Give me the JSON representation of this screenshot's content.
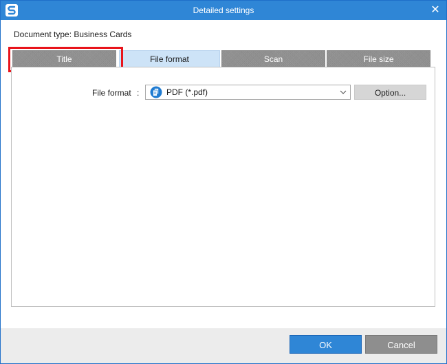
{
  "window": {
    "title": "Detailed settings",
    "close_icon": "close-icon",
    "app_icon": "scansnap-logo-icon",
    "accent_color": "#2f86d6"
  },
  "document_type_label": "Document type: Business Cards",
  "tabs": [
    {
      "label": "Title",
      "active": false,
      "highlighted": true
    },
    {
      "label": "File format",
      "active": true,
      "highlighted": false
    },
    {
      "label": "Scan",
      "active": false,
      "highlighted": false
    },
    {
      "label": "File size",
      "active": false,
      "highlighted": false
    }
  ],
  "highlight_color": "#e8141b",
  "file_format": {
    "label": "File format",
    "separator": ":",
    "selected_value": "PDF (*.pdf)",
    "icon": "pdf-file-icon",
    "option_button_label": "Option..."
  },
  "footer": {
    "ok_label": "OK",
    "cancel_label": "Cancel"
  }
}
